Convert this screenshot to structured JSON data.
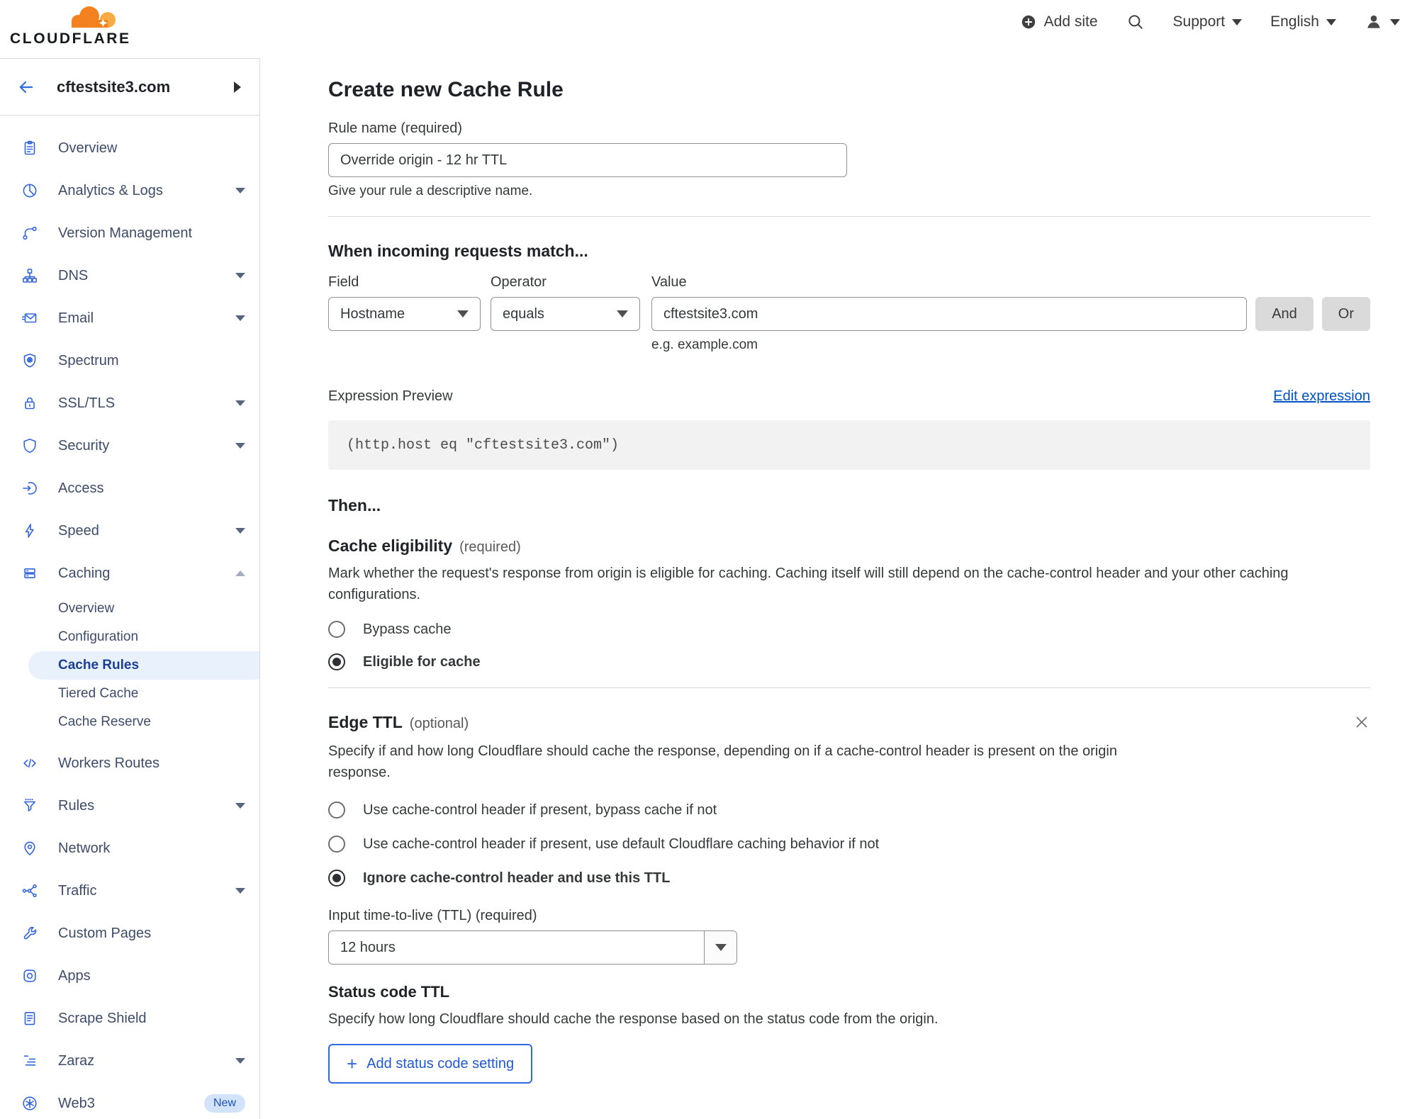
{
  "colors": {
    "brand_orange": "#f48120",
    "brand_orange_light": "#f9ab41",
    "sidebar_icon_blue": "#3265d9",
    "sidebar_text": "#3e4c6b",
    "active_item_bg": "#e8f1fc",
    "active_item_text": "#1c3f94",
    "link_blue": "#0051c3",
    "outline_button_blue": "#2f6bdf",
    "code_box_bg": "#f2f2f2",
    "divider": "#d6d6d6"
  },
  "topbar": {
    "brand": "CLOUDFLARE",
    "add_site": "Add site",
    "support": "Support",
    "language": "English"
  },
  "sidebar": {
    "site_name": "cftestsite3.com",
    "items": [
      {
        "label": "Overview"
      },
      {
        "label": "Analytics & Logs"
      },
      {
        "label": "Version Management"
      },
      {
        "label": "DNS"
      },
      {
        "label": "Email"
      },
      {
        "label": "Spectrum"
      },
      {
        "label": "SSL/TLS"
      },
      {
        "label": "Security"
      },
      {
        "label": "Access"
      },
      {
        "label": "Speed"
      },
      {
        "label": "Caching"
      },
      {
        "label": "Workers Routes"
      },
      {
        "label": "Rules"
      },
      {
        "label": "Network"
      },
      {
        "label": "Traffic"
      },
      {
        "label": "Custom Pages"
      },
      {
        "label": "Apps"
      },
      {
        "label": "Scrape Shield"
      },
      {
        "label": "Zaraz"
      },
      {
        "label": "Web3"
      }
    ],
    "caching_children": [
      {
        "label": "Overview"
      },
      {
        "label": "Configuration"
      },
      {
        "label": "Cache Rules",
        "active": true
      },
      {
        "label": "Tiered Cache"
      },
      {
        "label": "Cache Reserve"
      }
    ],
    "web3_badge": "New"
  },
  "main": {
    "title": "Create new Cache Rule",
    "rule_name": {
      "label": "Rule name (required)",
      "value": "Override origin - 12 hr TTL",
      "helper": "Give your rule a descriptive name."
    },
    "match": {
      "heading": "When incoming requests match...",
      "field_label": "Field",
      "field_value": "Hostname",
      "operator_label": "Operator",
      "operator_value": "equals",
      "value_label": "Value",
      "value_text": "cftestsite3.com",
      "value_helper": "e.g. example.com",
      "and_label": "And",
      "or_label": "Or"
    },
    "expression": {
      "label": "Expression Preview",
      "edit_link": "Edit expression",
      "code": "(http.host eq \"cftestsite3.com\")"
    },
    "then_heading": "Then...",
    "eligibility": {
      "heading": "Cache eligibility",
      "qualifier": "(required)",
      "description": "Mark whether the request's response from origin is eligible for caching. Caching itself will still depend on the cache-control header and your other caching configurations.",
      "options": [
        {
          "label": "Bypass cache",
          "selected": false
        },
        {
          "label": "Eligible for cache",
          "selected": true
        }
      ]
    },
    "edge_ttl": {
      "heading": "Edge TTL",
      "qualifier": "(optional)",
      "description": "Specify if and how long Cloudflare should cache the response, depending on if a cache-control header is present on the origin response.",
      "options": [
        {
          "label": "Use cache-control header if present, bypass cache if not",
          "selected": false
        },
        {
          "label": "Use cache-control header if present, use default Cloudflare caching behavior if not",
          "selected": false
        },
        {
          "label": "Ignore cache-control header and use this TTL",
          "selected": true
        }
      ],
      "ttl_label": "Input time-to-live (TTL) (required)",
      "ttl_value": "12 hours"
    },
    "status_ttl": {
      "heading": "Status code TTL",
      "description": "Specify how long Cloudflare should cache the response based on the status code from the origin.",
      "add_button": "Add status code setting"
    }
  }
}
